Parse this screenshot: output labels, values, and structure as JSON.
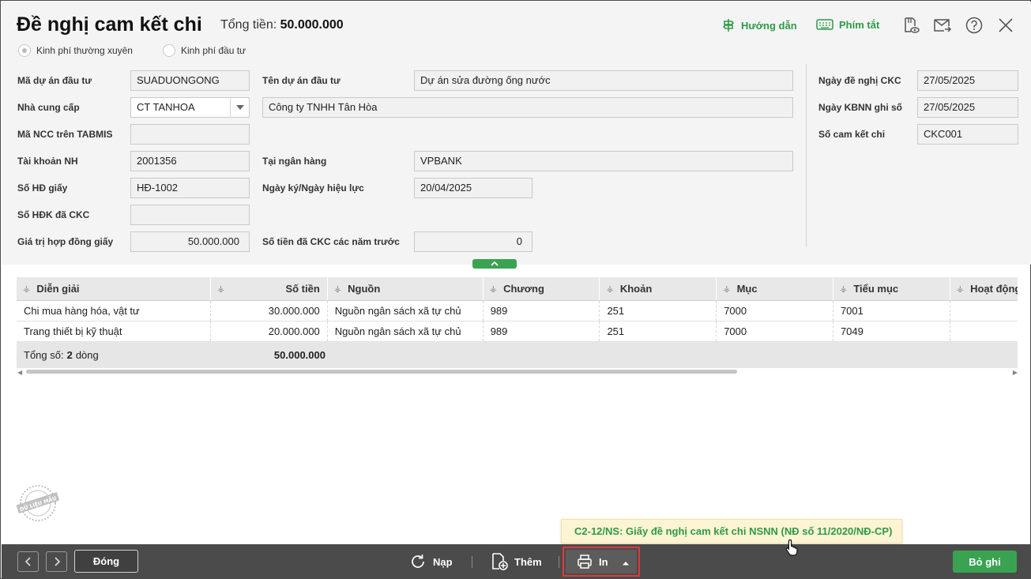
{
  "header": {
    "title": "Đề nghị cam kết chi",
    "total_label": "Tổng tiền:",
    "total_value": "50.000.000",
    "help_label": "Hướng dẫn",
    "shortcut_label": "Phím tắt"
  },
  "radios": {
    "regular": "Kinh phí thường xuyên",
    "investment": "Kinh phí đầu tư",
    "selected": "regular"
  },
  "form": {
    "project_code_label": "Mã dự án đầu tư",
    "project_code": "SUADUONGONG",
    "project_name_label": "Tên dự án đầu tư",
    "project_name": "Dự án sửa đường ống nước",
    "supplier_label": "Nhà cung cấp",
    "supplier_code": "CT TANHOA",
    "supplier_name": "Công ty TNHH Tân Hòa",
    "tabmis_label": "Mã NCC trên TABMIS",
    "tabmis_value": "",
    "bank_account_label": "Tài khoản NH",
    "bank_account": "2001356",
    "bank_label": "Tại ngân hàng",
    "bank": "VPBANK",
    "contract_no_label": "Số HĐ giấy",
    "contract_no": "HĐ-1002",
    "sign_date_label": "Ngày ký/Ngày hiệu lực",
    "sign_date": "20/04/2025",
    "hdk_label": "Số HĐK đã CKC",
    "hdk_value": "",
    "contract_value_label": "Giá trị hợp đồng giấy",
    "contract_value": "50.000.000",
    "prev_years_label": "Số tiền đã CKC các năm trước",
    "prev_years": "0",
    "request_date_label": "Ngày đề nghị CKC",
    "request_date": "27/05/2025",
    "kbnn_date_label": "Ngày KBNN ghi số",
    "kbnn_date": "27/05/2025",
    "ckc_no_label": "Số cam kết chi",
    "ckc_no": "CKC001"
  },
  "grid": {
    "columns": [
      "Diễn giải",
      "Số tiền",
      "Nguồn",
      "Chương",
      "Khoản",
      "Mục",
      "Tiểu mục",
      "Hoạt động"
    ],
    "rows": [
      [
        "Chi mua hàng hóa, vật tư",
        "30.000.000",
        "Nguồn ngân sách xã tự chủ",
        "989",
        "251",
        "7000",
        "7001",
        ""
      ],
      [
        "Trang thiết bị kỹ thuật",
        "20.000.000",
        "Nguồn ngân sách xã tự chủ",
        "989",
        "251",
        "7000",
        "7049",
        ""
      ]
    ],
    "footer_prefix": "Tổng số:",
    "footer_count": "2",
    "footer_suffix": "dòng",
    "footer_total": "50.000.000"
  },
  "stamp_text": "DỮ LIỆU MẪU",
  "tooltip": "C2-12/NS: Giấy đề nghị cam kết chi NSNN (NĐ số 11/2020/NĐ-CP)",
  "footer": {
    "close_label": "Đóng",
    "reload_label": "Nạp",
    "add_label": "Thêm",
    "print_label": "In",
    "cancel_label": "Bỏ ghi"
  },
  "colors": {
    "accent_green": "#3aa351",
    "link_green": "#2e9a48",
    "footer_bg": "#4b4b4b",
    "highlight_red": "#e03a3a",
    "tooltip_bg": "#fcf4d3"
  }
}
